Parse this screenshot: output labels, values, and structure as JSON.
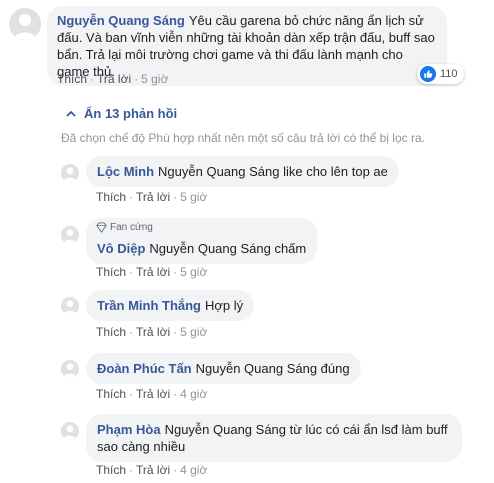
{
  "main_comment": {
    "author": "Nguyễn Quang Sáng",
    "text": "Yêu cầu garena bỏ chức năng ẩn lịch sử đấu. Và ban vĩnh viễn những tài khoản dàn xếp trận đấu, buff sao bẩn. Trả lại môi trường chơi game và thi đấu lành mạnh cho game thủ.",
    "like_label": "Thích",
    "reply_label": "Trả lời",
    "time": "5 giờ",
    "reaction_count": "110",
    "colors": {
      "reaction_blue": "#1877f2",
      "name": "#385898"
    }
  },
  "replies_toggle": {
    "label": "Ẩn 13 phản hồi",
    "filter_note": "Đã chọn chế độ Phù hợp nhất nên một số câu trả lời có thể bị lọc ra."
  },
  "replies": [
    {
      "author": "Lộc Minh",
      "text": "Nguyễn Quang Sáng like cho lên top ae",
      "like_label": "Thích",
      "reply_label": "Trả lời",
      "time": "5 giờ"
    },
    {
      "badge": "Fan cứng",
      "author": "Vô Diệp",
      "text": "Nguyễn Quang Sáng chấm",
      "like_label": "Thích",
      "reply_label": "Trả lời",
      "time": "5 giờ"
    },
    {
      "author": "Trần Minh Thắng",
      "text": "Hợp lý",
      "like_label": "Thích",
      "reply_label": "Trả lời",
      "time": "5 giờ"
    },
    {
      "author": "Đoàn Phúc Tấn",
      "text": "Nguyễn Quang Sáng đúng",
      "like_label": "Thích",
      "reply_label": "Trả lời",
      "time": "4 giờ"
    },
    {
      "author": "Phạm Hòa",
      "text": "Nguyễn Quang Sáng từ lúc có cái ẩn lsđ làm buff sao càng nhiều",
      "like_label": "Thích",
      "reply_label": "Trả lời",
      "time": "4 giờ"
    }
  ]
}
